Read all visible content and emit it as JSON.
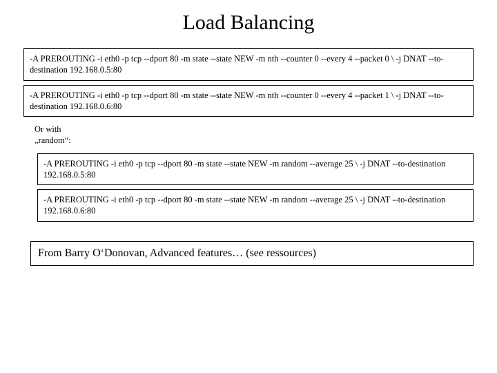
{
  "title": "Load Balancing",
  "rules": {
    "nth1": "-A PREROUTING -i eth0 -p tcp --dport 80 -m state --state NEW -m nth --counter 0 --every 4 --packet 0 \\ -j DNAT --to-destination 192.168.0.5:80",
    "nth2": "-A PREROUTING -i eth0 -p tcp --dport 80 -m state --state NEW -m nth --counter 0 --every 4 --packet 1 \\ -j DNAT --to-destination 192.168.0.6:80"
  },
  "note": {
    "line1": "Or with",
    "line2": "„random“:"
  },
  "random_rules": {
    "r1": "-A PREROUTING -i eth0 -p tcp --dport 80 -m state --state NEW -m random --average 25 \\ -j DNAT --to-destination 192.168.0.5:80",
    "r2": "-A PREROUTING -i eth0 -p tcp --dport 80 -m state --state NEW -m random --average 25 \\ -j DNAT --to-destination 192.168.0.6:80"
  },
  "footer": "From Barry O‘Donovan, Advanced features… (see ressources)"
}
